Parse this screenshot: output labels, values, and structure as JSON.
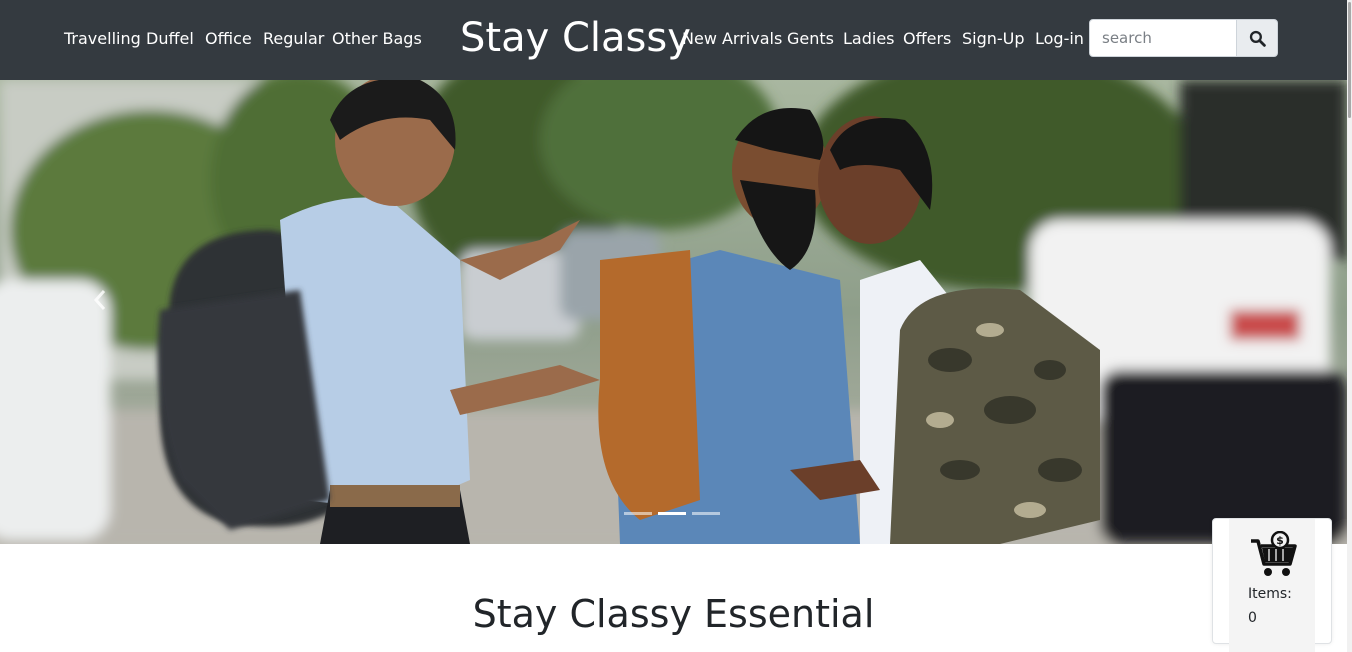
{
  "navbar": {
    "left_links": [
      "Travelling",
      "Duffel",
      "Office",
      "Regular",
      "Other Bags"
    ],
    "brand": "Stay Classy",
    "right_links": [
      "New Arrivals",
      "Gents",
      "Ladies",
      "Offers",
      "Sign-Up",
      "Log-in"
    ],
    "search": {
      "placeholder": "search",
      "value": ""
    },
    "colors": {
      "background": "#343a40",
      "text": "#ffffff"
    }
  },
  "carousel": {
    "slide_count": 3,
    "active_index": 1
  },
  "section": {
    "title": "Stay Classy Essential"
  },
  "cart": {
    "label": "Items:",
    "count": "0",
    "icon": "shopping-cart-dollar-icon"
  }
}
